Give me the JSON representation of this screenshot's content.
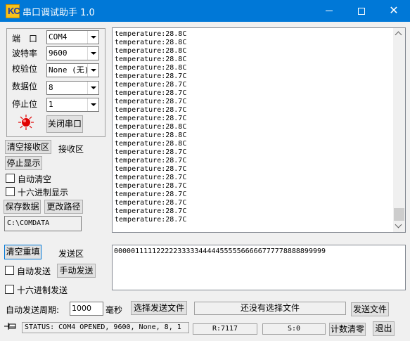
{
  "window": {
    "title": "串口调试助手 1.0",
    "app_icon_text": "KC",
    "accent": "#0078d7"
  },
  "settings": {
    "port_label": "端　口",
    "port_value": "COM4",
    "baud_label": "波特率",
    "baud_value": "9600",
    "parity_label": "校验位",
    "parity_value": "None (无)",
    "databits_label": "数据位",
    "databits_value": "8",
    "stopbits_label": "停止位",
    "stopbits_value": "1",
    "close_port_button": "关闭串口",
    "led_color": "#e00000"
  },
  "receive": {
    "clear_button": "清空接收区",
    "area_label": "接收区",
    "stop_display_button": "停止显示",
    "auto_clear_label": "自动清空",
    "hex_display_label": "十六进制显示",
    "save_data_button": "保存数据",
    "change_path_button": "更改路径",
    "path_value": "C:\\COMDATA",
    "lines": [
      "temperature:28.8C",
      "temperature:28.8C",
      "temperature:28.8C",
      "temperature:28.8C",
      "temperature:28.8C",
      "temperature:28.7C",
      "temperature:28.7C",
      "temperature:28.7C",
      "temperature:28.7C",
      "temperature:28.7C",
      "temperature:28.7C",
      "temperature:28.8C",
      "temperature:28.8C",
      "temperature:28.8C",
      "temperature:28.7C",
      "temperature:28.7C",
      "temperature:28.7C",
      "temperature:28.7C",
      "temperature:28.7C",
      "temperature:28.7C",
      "temperature:28.7C",
      "temperature:28.7C",
      "temperature:28.7C"
    ]
  },
  "send": {
    "clear_resend_button": "清空重填",
    "area_label": "发送区",
    "auto_send_label": "自动发送",
    "manual_send_button": "手动发送",
    "hex_send_label": "十六进制发送",
    "text": "00000111112222233333444445555566666777778888899999",
    "period_label": "自动发送周期:",
    "period_value": "1000",
    "period_unit": "毫秒",
    "select_file_button": "选择发送文件",
    "file_status": "还没有选择文件",
    "send_file_button": "发送文件"
  },
  "statusbar": {
    "pin_icon": "pushpin-icon",
    "status_text": "STATUS: COM4 OPENED, 9600, None, 8, 1",
    "rx_count": "R:7117",
    "tx_count": "S:0",
    "reset_count_button": "计数清零",
    "exit_button": "退出"
  }
}
